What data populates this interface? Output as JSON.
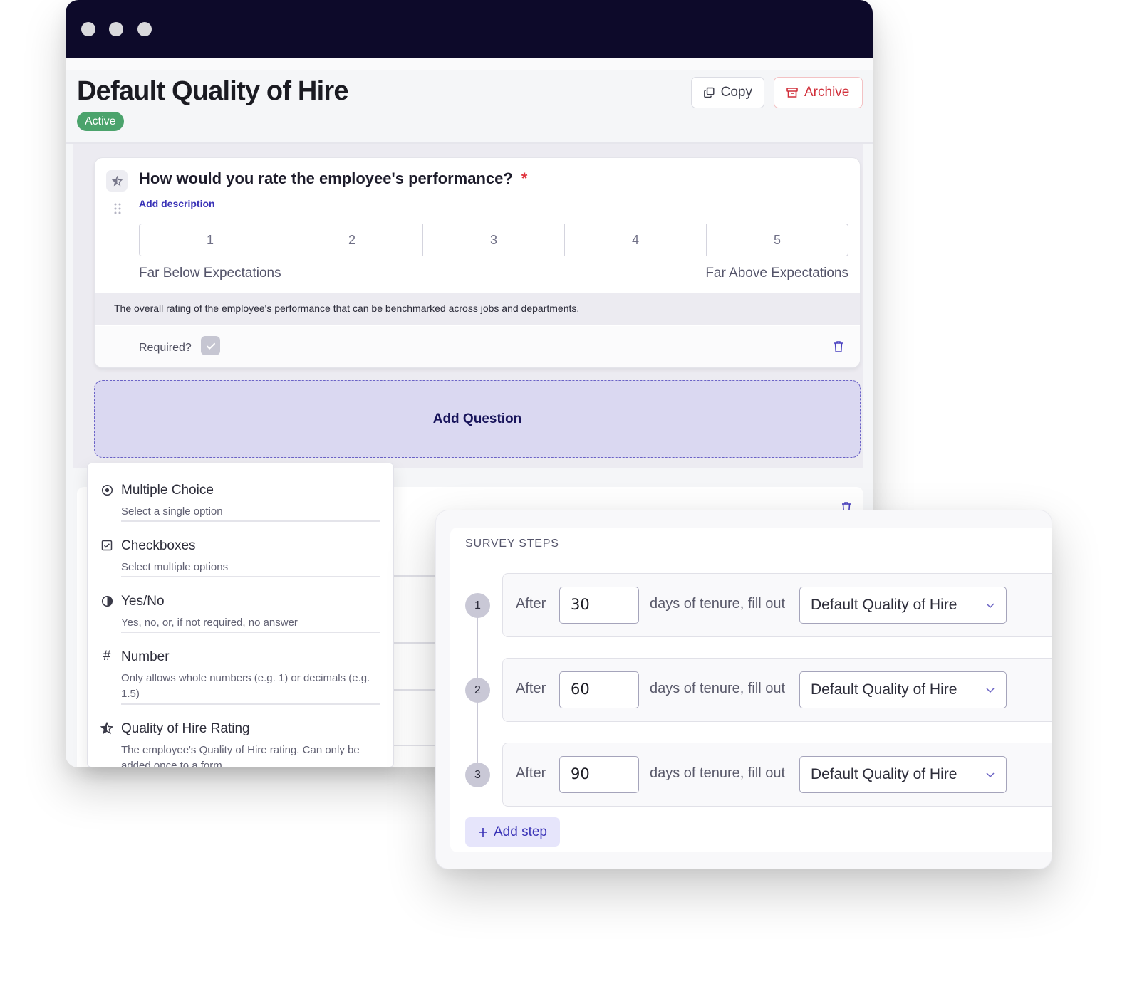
{
  "window": {
    "title": "Default Quality of Hire",
    "status_badge": "Active",
    "actions": {
      "copy_label": "Copy",
      "archive_label": "Archive"
    }
  },
  "question": {
    "icon": "star-icon",
    "title": "How would you rate the employee's performance?",
    "required_marker": "*",
    "add_description_label": "Add description",
    "scale": [
      "1",
      "2",
      "3",
      "4",
      "5"
    ],
    "low_label": "Far Below Expectations",
    "high_label": "Far Above Expectations",
    "description": "The overall rating of the employee's performance that can be benchmarked across jobs and departments.",
    "required_label": "Required?",
    "required_checked": true
  },
  "add_question_label": "Add Question",
  "question_type_menu": {
    "items": [
      {
        "icon": "radio-icon",
        "title": "Multiple Choice",
        "subtitle": "Select a single option"
      },
      {
        "icon": "checkbox-icon",
        "title": "Checkboxes",
        "subtitle": "Select multiple options"
      },
      {
        "icon": "half-circle-icon",
        "title": "Yes/No",
        "subtitle": "Yes, no, or, if not required, no answer"
      },
      {
        "icon": "hash-icon",
        "title": "Number",
        "subtitle": "Only allows whole numbers (e.g. 1) or decimals (e.g. 1.5)"
      },
      {
        "icon": "star-icon",
        "title": "Quality of Hire Rating",
        "subtitle": "The employee's Quality of Hire rating. Can only be added once to a form"
      }
    ]
  },
  "survey_steps": {
    "title": "SURVEY STEPS",
    "steps": [
      {
        "number": "1",
        "prefix": "After",
        "days": "30",
        "middle": "days of tenure, fill out",
        "form": "Default Quality of Hire"
      },
      {
        "number": "2",
        "prefix": "After",
        "days": "60",
        "middle": "days of tenure, fill out",
        "form": "Default Quality of Hire"
      },
      {
        "number": "3",
        "prefix": "After",
        "days": "90",
        "middle": "days of tenure, fill out",
        "form": "Default Quality of Hire"
      }
    ],
    "add_step_label": "Add step"
  },
  "colors": {
    "titlebar": "#0d0a2a",
    "accent": "#3a33b7",
    "active_badge": "#4ba36c",
    "archive": "#d12f3a",
    "add_question_bg": "#dad8f1"
  }
}
